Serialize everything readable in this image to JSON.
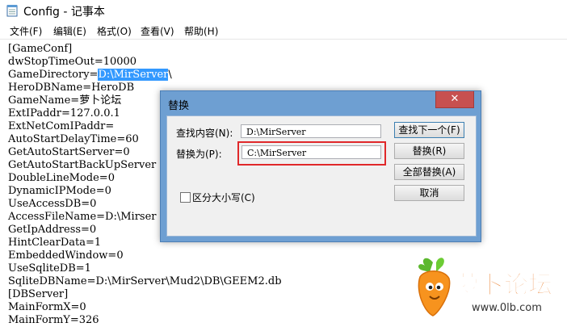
{
  "window": {
    "title": "Config - 记事本"
  },
  "menu": [
    {
      "label": "文件(F)"
    },
    {
      "label": "编辑(E)"
    },
    {
      "label": "格式(O)"
    },
    {
      "label": "查看(V)"
    },
    {
      "label": "帮助(H)"
    }
  ],
  "editor": {
    "lines": [
      "[GameConf]",
      "dwStopTimeOut=10000",
      "GameDirectory=",
      "HeroDBName=HeroDB",
      "GameName=萝卜论坛",
      "ExtIPaddr=127.0.0.1",
      "ExtNetComIPaddr=",
      "AutoStartDelayTime=60",
      "GetAutoStartServer=0",
      "GetAutoStartBackUpServer",
      "DoubleLineMode=0",
      "DynamicIPMode=0",
      "UseAccessDB=0",
      "AccessFileName=D:\\Mirser",
      "GetIpAddress=0",
      "HintClearData=1",
      "EmbeddedWindow=0",
      "UseSqliteDB=1",
      "SqliteDBName=D:\\MirServer\\Mud2\\DB\\GEEM2.db",
      "[DBServer]",
      "MainFormX=0",
      "MainFormY=326"
    ],
    "selected_text": "D:\\MirServer",
    "after_selection": "\\"
  },
  "dialog": {
    "title": "替换",
    "close_glyph": "✕",
    "find_label": "查找内容(N):",
    "find_value": "D:\\MirServer",
    "replace_label": "替换为(P):",
    "replace_value": "C:\\MirServer",
    "match_case_label": "区分大小写(C)",
    "buttons": {
      "find_next": "查找下一个(F)",
      "replace": "替换(R)",
      "replace_all": "全部替换(A)",
      "cancel": "取消"
    }
  },
  "watermark": {
    "text": "萝卜论坛",
    "url": "www.0lb.com"
  }
}
